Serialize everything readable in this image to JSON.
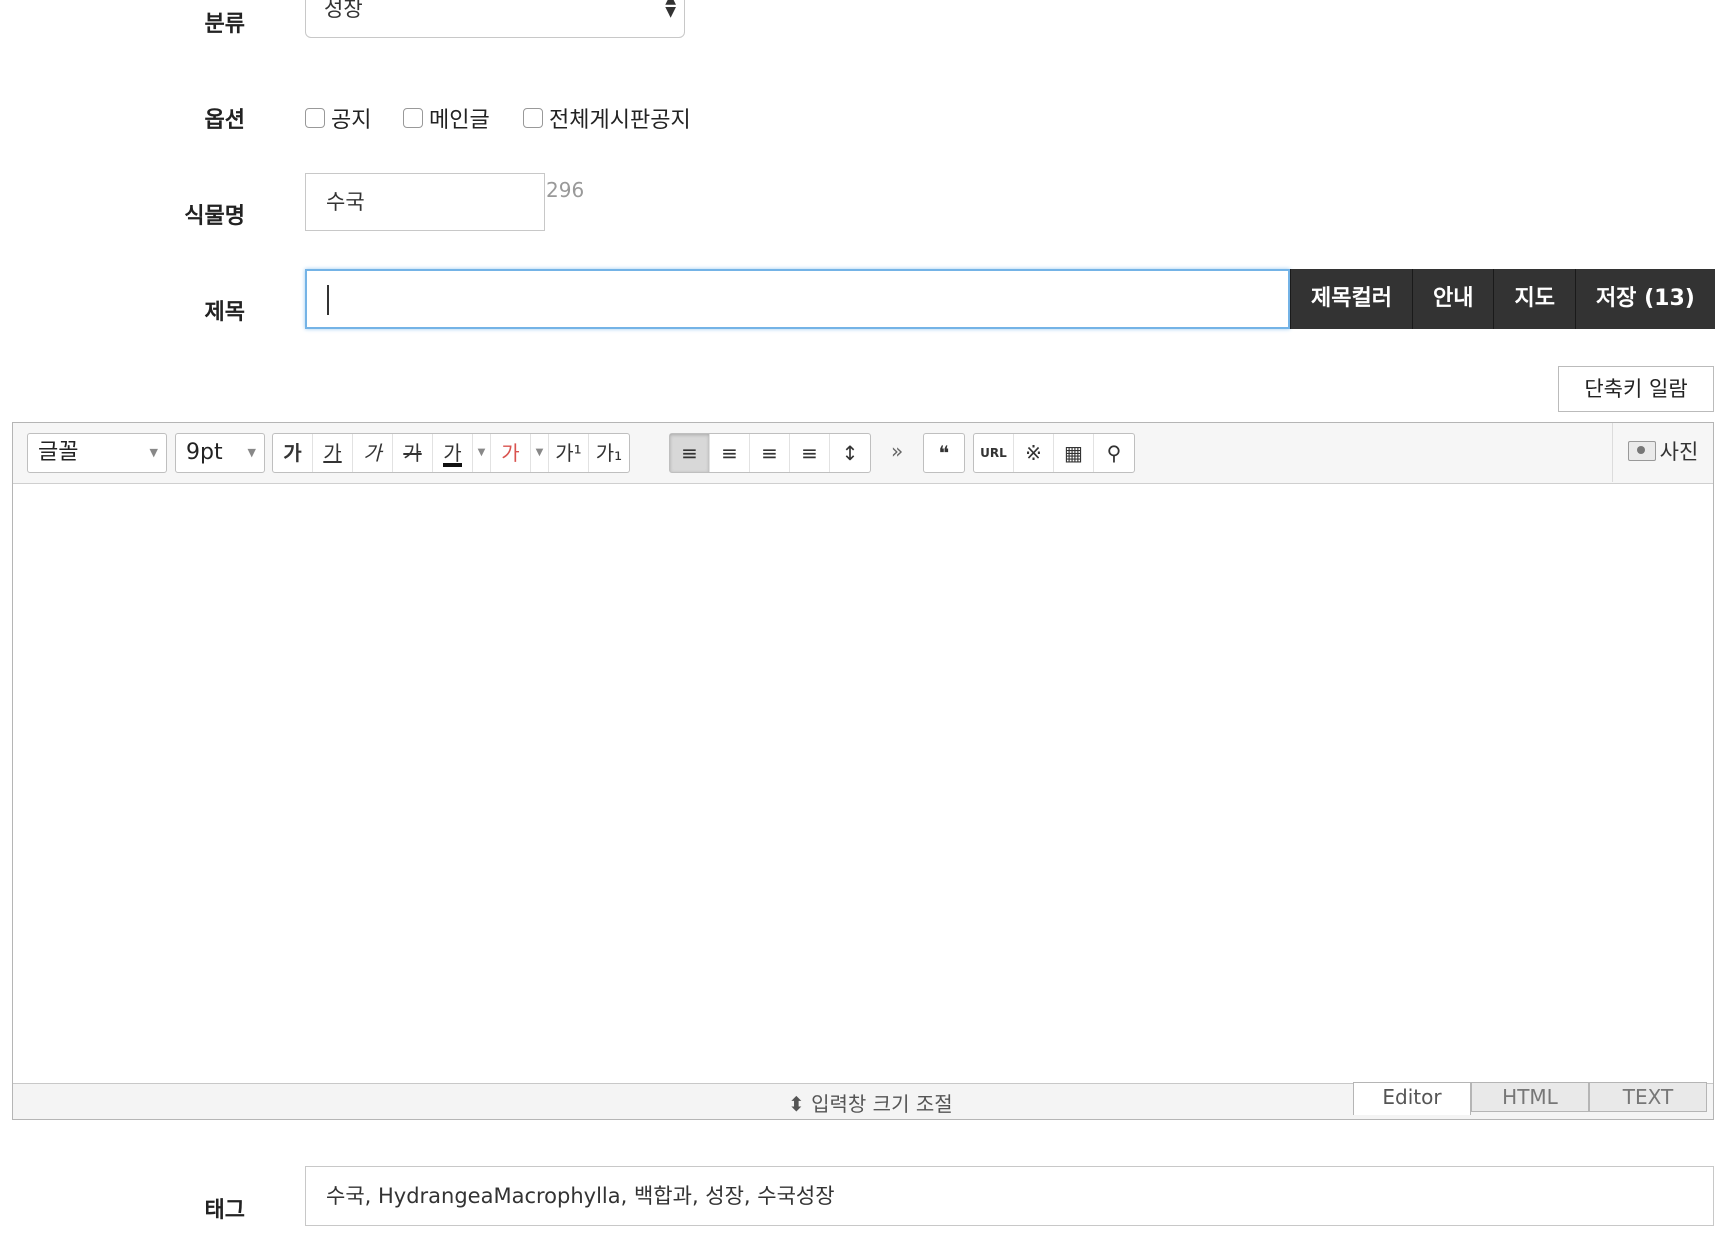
{
  "labels": {
    "category": "분류",
    "options": "옵션",
    "plant_name": "식물명",
    "title": "제목",
    "tags": "태그"
  },
  "category_select": {
    "value": "성장"
  },
  "options": [
    {
      "label": "공지",
      "checked": false
    },
    {
      "label": "메인글",
      "checked": false
    },
    {
      "label": "전체게시판공지",
      "checked": false
    }
  ],
  "plant_name": {
    "value": "수국",
    "count": "296"
  },
  "title": {
    "value": "",
    "buttons": [
      "제목컬러",
      "안내",
      "지도",
      "저장 (13)"
    ]
  },
  "shortcut_button": "단축키 일람",
  "editor": {
    "font_select": "글꼴",
    "size_select": "9pt",
    "format_buttons": [
      "가",
      "가",
      "가",
      "가",
      "가"
    ],
    "color_buttons": [
      "가",
      "가"
    ],
    "script_buttons": [
      "가¹",
      "가₁"
    ],
    "align_buttons": [
      "≡",
      "≡",
      "≡",
      "≡",
      "↕"
    ],
    "more": "»",
    "quote": "❝",
    "insert_buttons": [
      "URL",
      "※",
      "▦",
      "⚲"
    ],
    "photo_label": "사진",
    "resize_label": "⬍ 입력창 크기 조절",
    "modes": [
      "Editor",
      "HTML",
      "TEXT"
    ]
  },
  "tags": {
    "value": "수국, HydrangeaMacrophylla, 백합과, 성장, 수국성장"
  }
}
